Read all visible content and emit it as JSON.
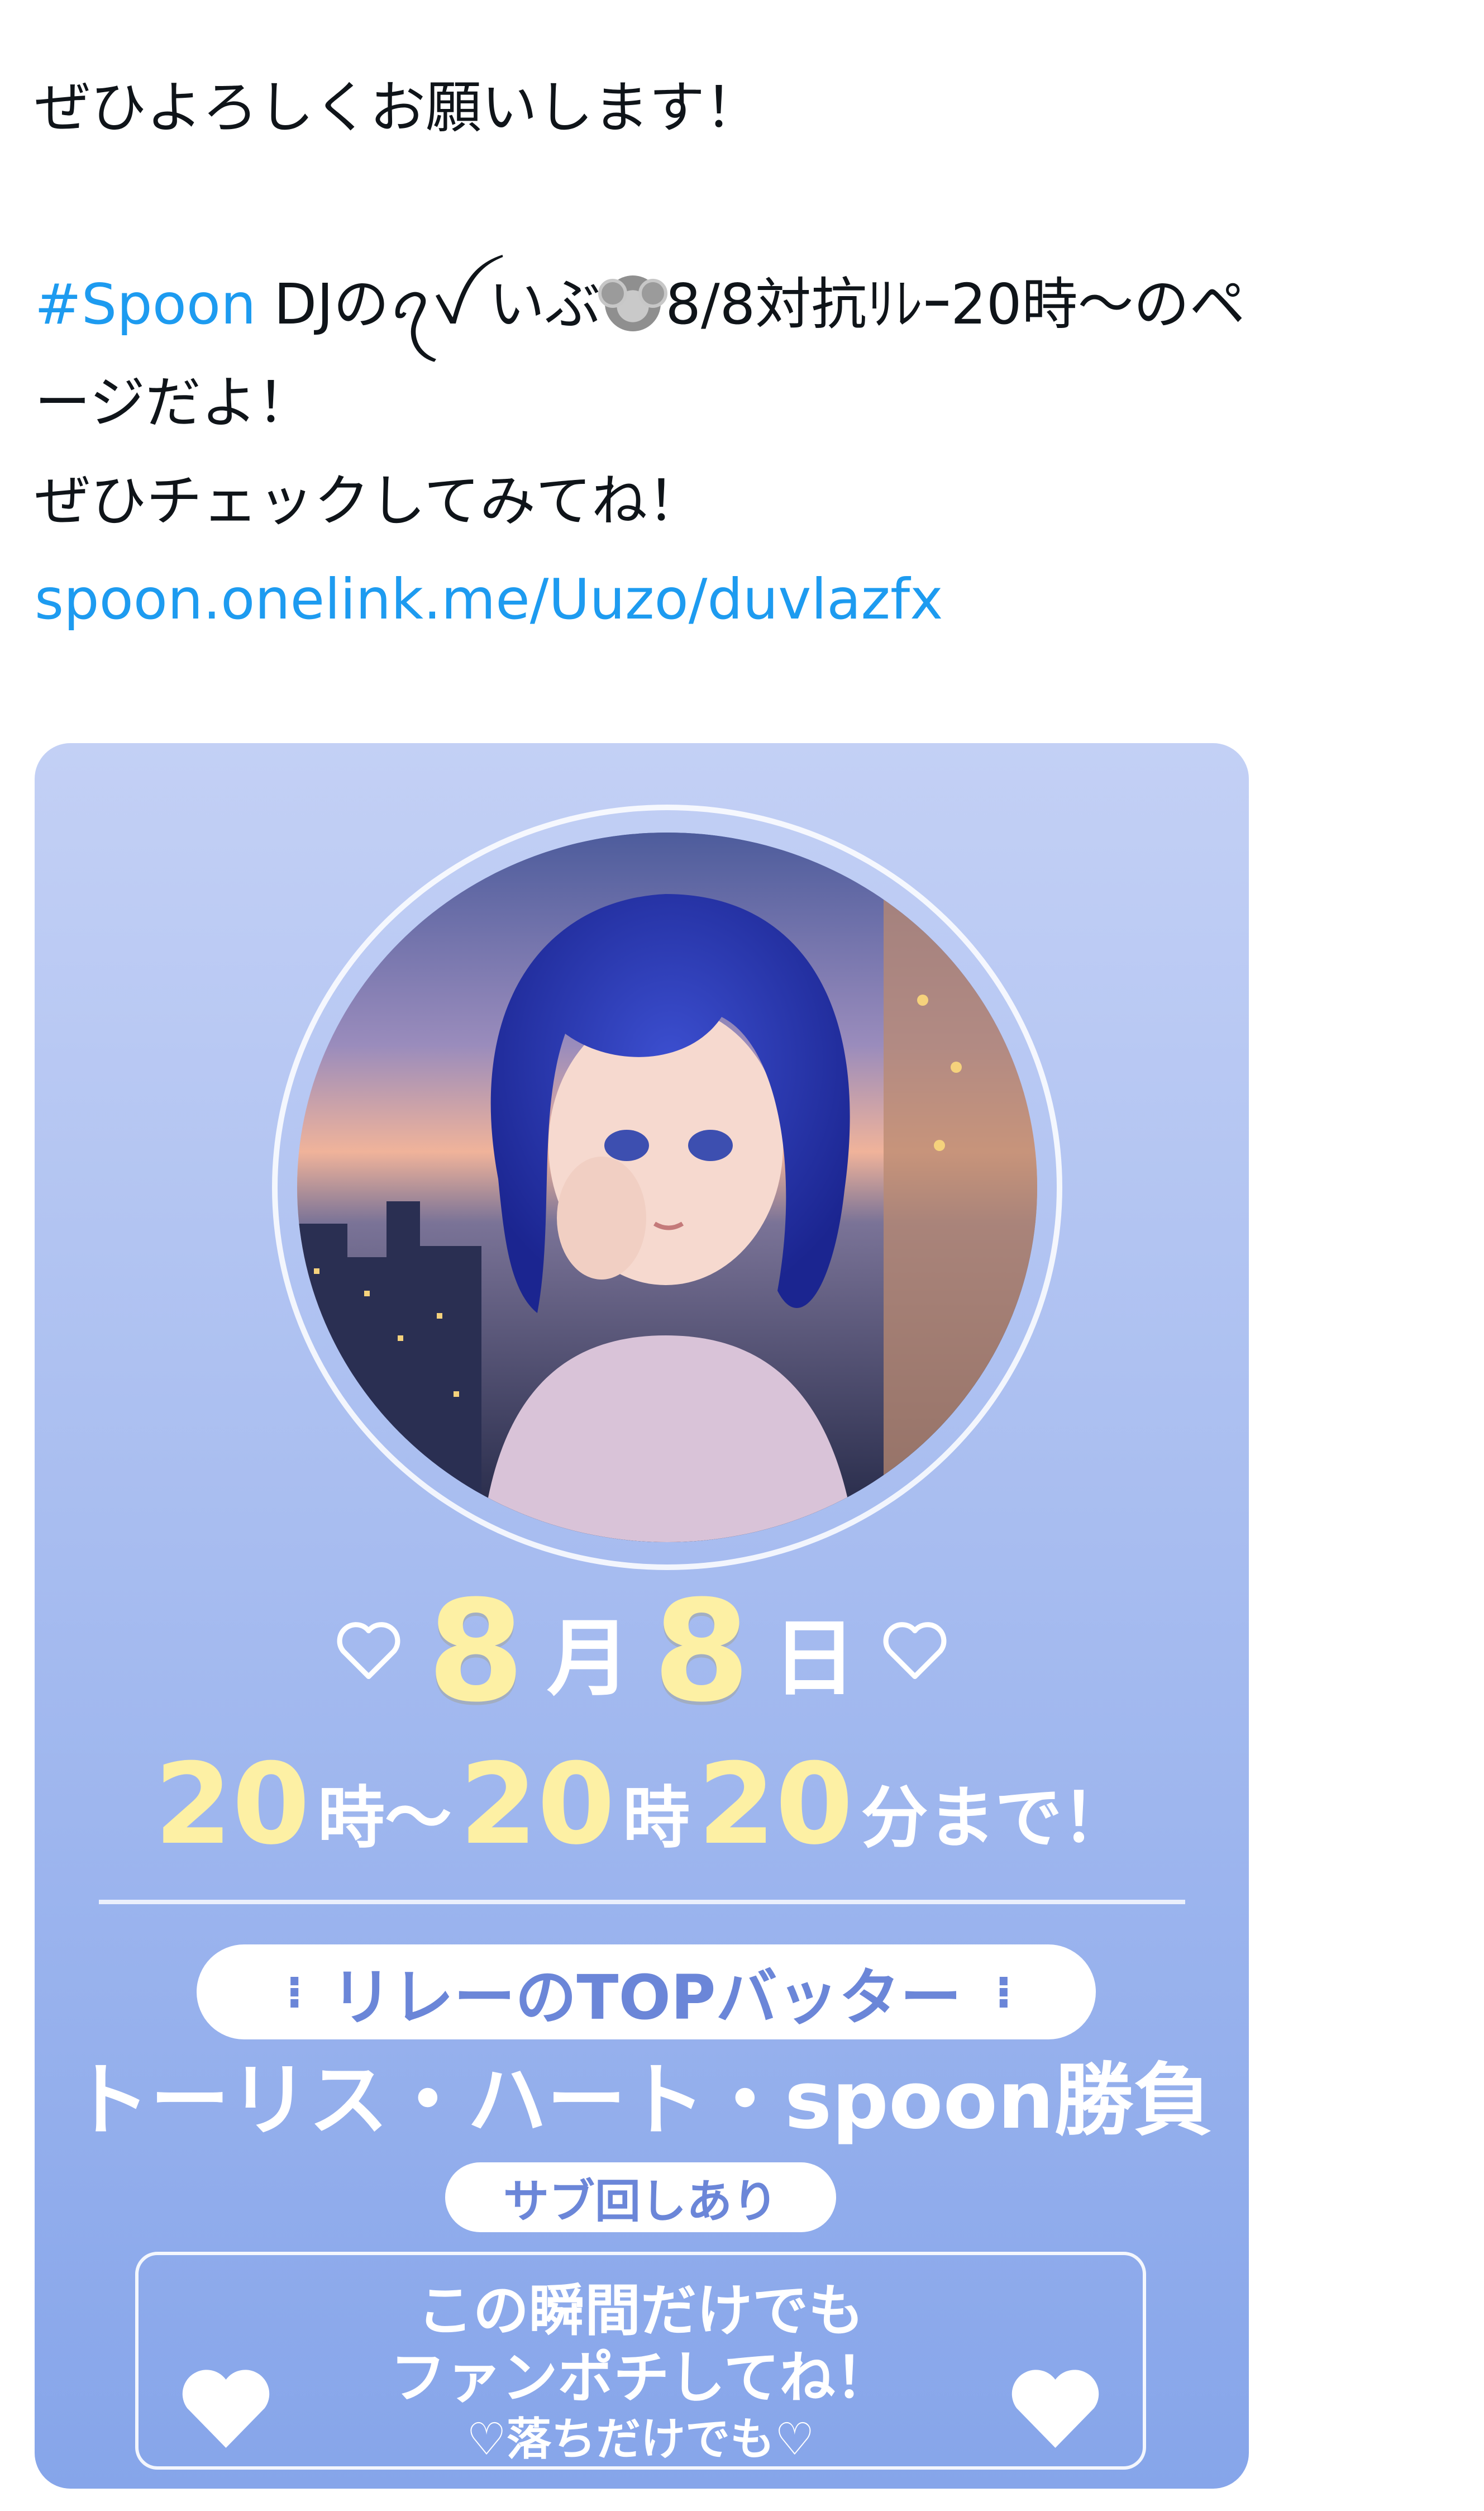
{
  "tweet": {
    "line1": "ぜひよろしくお願いします！",
    "hashtag": "#Spoon",
    "line2_rest_a": " DJのꪖꪜ いぶ",
    "emoji": "koala-emoji",
    "line2_rest_b": "8/8対抗ﾘﾚｰ20時〜のペ",
    "line3": "ージだよ！",
    "line4": "ぜひチェックしてみてね！",
    "link": "spoon.onelink.me/Uuzo/duvlazfx"
  },
  "card": {
    "date_month_num": "8",
    "date_month": "月",
    "date_day_num": "8",
    "date_day": "日",
    "time_num1": "20",
    "time_unit1": "時〜",
    "time_num2": "20",
    "time_unit2": "時",
    "time_num3": "20",
    "time_unit3": "分まで！",
    "pill_top": "リレーのTOPバッター",
    "headline": "トーリス・ハート・spoon勝負",
    "pill_sub": "サブ回しあり",
    "box_line1": "この瞬間だけでも",
    "box_line2": "ファンポチしてね！",
    "box_line3": "♡落ちだけでも♡",
    "colors": {
      "background_top": "#c3d0f5",
      "background_bottom": "#86a5ea",
      "number_yellow": "#fdf0a4",
      "accent_blue": "#6b86d8"
    }
  }
}
